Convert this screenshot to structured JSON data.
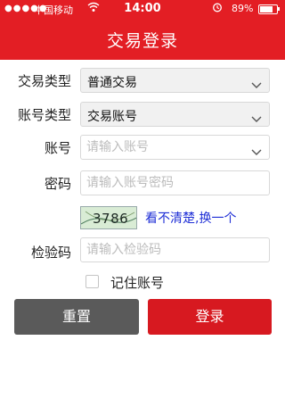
{
  "status_bar": {
    "signal": "●●●●●",
    "carrier": "中国移动",
    "time": "14:00",
    "battery_text": "89%",
    "battery_level": 0.89
  },
  "header": {
    "title": "交易登录"
  },
  "form": {
    "trade_type": {
      "label": "交易类型",
      "value": "普通交易"
    },
    "account_type": {
      "label": "账号类型",
      "value": "交易账号"
    },
    "account": {
      "label": "账号",
      "placeholder": "请输入账号"
    },
    "password": {
      "label": "密码",
      "placeholder": "请输入账号密码"
    },
    "captcha": {
      "code": "3786",
      "refresh_label": "看不清楚,换一个"
    },
    "verify_code": {
      "label": "检验码",
      "placeholder": "请输入检验码"
    },
    "remember_label": "记住账号"
  },
  "buttons": {
    "reset": "重置",
    "login": "登录"
  },
  "colors": {
    "brand": "#e31e24",
    "login": "#d71920",
    "reset": "#5a5a5a",
    "link": "#1f2fd6"
  },
  "icons": [
    "signal-icon",
    "wifi-icon",
    "alarm-icon",
    "battery-icon",
    "chevron-down-icon"
  ]
}
